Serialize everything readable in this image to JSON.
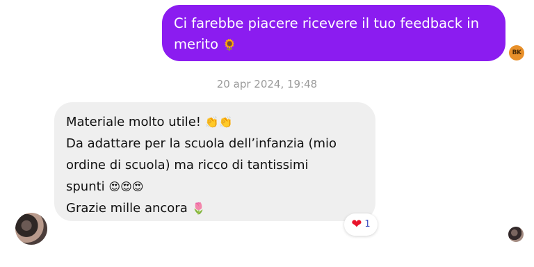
{
  "sent_message": {
    "text": "Ci farebbe piacere ricevere il tuo feedback in merito",
    "emoji": "🌻",
    "avatar_initials": "BK"
  },
  "timestamp": "20 apr 2024, 19:48",
  "received_message": {
    "lines": [
      {
        "text": "Materiale molto utile! ",
        "emoji": "👏👏"
      },
      {
        "text": "Da adattare per la scuola dell’infanzia (mio",
        "emoji": ""
      },
      {
        "text": "ordine di scuola) ma ricco di tantissimi",
        "emoji": ""
      },
      {
        "text": "spunti ",
        "emoji": "😍😍😍"
      },
      {
        "text": "Grazie mille ancora ",
        "emoji": "🌷"
      }
    ]
  },
  "reaction": {
    "icon": "❤",
    "count": "1"
  },
  "colors": {
    "sent_bubble": "#8b1cf0",
    "received_bubble": "#efefef",
    "reaction_heart": "#e8132a",
    "reaction_count": "#3b4cc0"
  }
}
